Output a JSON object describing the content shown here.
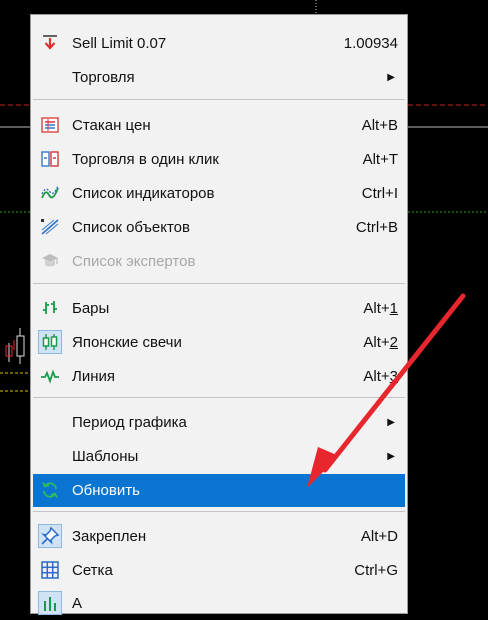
{
  "menu": {
    "sell_limit": {
      "label": "Sell Limit 0.07",
      "value": "1.00934",
      "icon": "sell-limit-icon"
    },
    "trade": {
      "label": "Торговля",
      "submenu": "▶"
    },
    "depth_of_market": {
      "label": "Стакан цен",
      "shortcut": "Alt+B",
      "icon": "depth-of-market-icon"
    },
    "one_click_trading": {
      "label": "Торговля в один клик",
      "shortcut": "Alt+T",
      "icon": "one-click-trading-icon"
    },
    "indicators_list": {
      "label": "Список индикаторов",
      "shortcut": "Ctrl+I",
      "icon": "indicators-icon"
    },
    "objects_list": {
      "label": "Список объектов",
      "shortcut": "Ctrl+B",
      "icon": "objects-icon"
    },
    "experts_list": {
      "label": "Список экспертов",
      "icon": "experts-icon",
      "disabled": true
    },
    "bars": {
      "label": "Бары",
      "shortcut_prefix": "Alt+",
      "shortcut_key": "1",
      "icon": "bars-chart-icon"
    },
    "candles": {
      "label": "Японские свечи",
      "shortcut_prefix": "Alt+",
      "shortcut_key": "2",
      "icon": "candlesticks-icon",
      "checked": true
    },
    "line": {
      "label": "Линия",
      "shortcut_prefix": "Alt+",
      "shortcut_key": "3",
      "icon": "line-chart-icon"
    },
    "period": {
      "label": "Период графика",
      "submenu": "▶"
    },
    "templates": {
      "label": "Шаблоны",
      "submenu": "▶"
    },
    "refresh": {
      "label": "Обновить",
      "icon": "refresh-icon",
      "selected": true
    },
    "pinned": {
      "label": "Закреплен",
      "shortcut": "Alt+D",
      "icon": "pin-icon",
      "checked": true
    },
    "grid": {
      "label": "Сетка",
      "shortcut": "Ctrl+G",
      "icon": "grid-icon"
    },
    "partial_next": {
      "label": "А"
    }
  },
  "colors": {
    "selection": "#0a75d0",
    "annotation_arrow": "#e8262d",
    "menu_bg": "#f2f2f2"
  }
}
